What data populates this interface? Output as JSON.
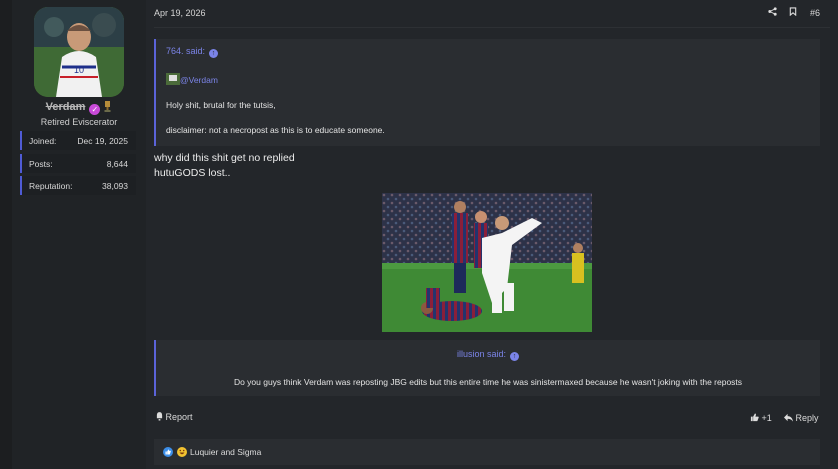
{
  "user": {
    "name": "Verdam",
    "title": "Retired Eviscerator",
    "avatar_icon": "avatar-image",
    "stats": [
      {
        "label": "Joined:",
        "value": "Dec 19, 2025"
      },
      {
        "label": "Posts:",
        "value": "8,644"
      },
      {
        "label": "Reputation:",
        "value": "38,093"
      }
    ]
  },
  "post": {
    "date": "Apr 19, 2026",
    "number": "#6",
    "quote1": {
      "author": "764. said:",
      "mention": "@Verdam",
      "line1": "Holy shit, brutal for the tutsis,",
      "line2": "disclaimer: not a necropost as this is to educate someone."
    },
    "text_line1": "why did this shit get no replied",
    "text_line2": "hutuGODS lost..",
    "quote2": {
      "author": "illusion said:",
      "text": "Do you guys think Verdam was reposting JBG edits but this entire time he was sinistermaxed because he wasn't joking with the reposts"
    },
    "actions": {
      "report": "Report",
      "like": "+1",
      "reply": "Reply"
    },
    "reactions": {
      "text": "Luquier and Sigma"
    }
  },
  "colors": {
    "accent": "#5b63d8",
    "link": "#7b84e8",
    "background": "#23262a"
  }
}
